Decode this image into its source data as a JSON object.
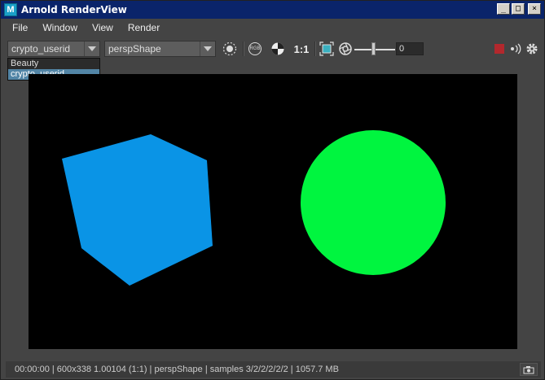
{
  "window": {
    "title": "Arnold RenderView",
    "app_icon_letter": "M"
  },
  "window_controls": {
    "minimize": "_",
    "maximize": "□",
    "close": "×"
  },
  "menu": {
    "items": [
      "File",
      "Window",
      "View",
      "Render"
    ]
  },
  "toolbar": {
    "aov_selected": "crypto_userid",
    "camera_selected": "perspShape",
    "rgb_label": "RGB",
    "ratio_label": "1:1",
    "exposure_value": "0"
  },
  "aov_dropdown": {
    "options": [
      "Beauty",
      "crypto_userid"
    ],
    "selected": "crypto_userid"
  },
  "render": {
    "cube_color": "#0a94e6",
    "sphere_color": "#00f53f",
    "background": "#000000"
  },
  "statusbar": {
    "text": "00:00:00 | 600x338 1.00104 (1:1) | perspShape  | samples 3/2/2/2/2/2 | 1057.7 MB"
  },
  "colors": {
    "stop_red": "#b3282d",
    "selection_blue": "#5285a6"
  }
}
